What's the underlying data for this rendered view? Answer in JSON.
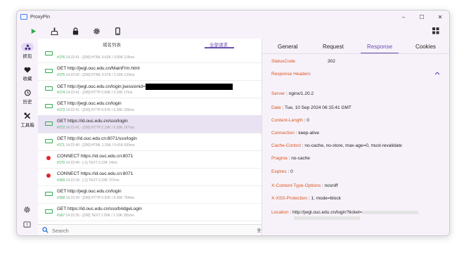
{
  "window": {
    "title": "ProxyPin",
    "controls": [
      "–",
      "☐",
      "✕"
    ]
  },
  "toolbar": {
    "icons": [
      "play-icon",
      "broom-icon",
      "lock-icon",
      "gear-icon",
      "phone-icon"
    ],
    "right_icon": "grid-icon"
  },
  "sidebar": {
    "items": [
      {
        "label": "抓包",
        "icon": "capture-icon",
        "active": true
      },
      {
        "label": "收藏",
        "icon": "heart-icon",
        "active": false
      },
      {
        "label": "历史",
        "icon": "history-icon",
        "active": false
      },
      {
        "label": "工具箱",
        "icon": "tools-icon",
        "active": false
      }
    ],
    "bottom_icons": [
      "settings-icon",
      "feedback-icon"
    ]
  },
  "list": {
    "subtabs": [
      "域名列表",
      "全部请求"
    ],
    "active_subtab": 1,
    "rows": [
      {
        "kind": "ok",
        "request": "",
        "id": "#176",
        "meta": " 14:22:41 - [200]  HTML 0.62K / 3.83K  115ms",
        "selected": false
      },
      {
        "kind": "ok",
        "request": "GET http://jwgl.ouc.edu.cn/MainFrm.html",
        "id": "#175",
        "meta": " 14:22:42 - [200]  HTML 0.57K / 2.16K  123ms",
        "selected": false
      },
      {
        "kind": "ok",
        "request": "GET http://jwgl.ouc.edu.cn/login;jsessionid=",
        "redacted": true,
        "id": "#174",
        "meta": " 14:22:41 - [200]  HTTP 0.60K / 0.20K  17ms",
        "selected": false
      },
      {
        "kind": "ok",
        "request": "GET http://jwgl.ouc.edu.cn/login",
        "id": "#173",
        "meta": " 14:22:41 - [200]  HTTP 0.57K / 0.30K  235ms",
        "selected": false
      },
      {
        "kind": "ok",
        "request": "GET https://id.ouc.edu.cn/sso/login",
        "id": "#172",
        "meta": " 14:22:41 - [200]  HTTP 2.19K / 0.30K  167ms",
        "selected": true
      },
      {
        "kind": "ok",
        "request": "GET http://id.ouc.edu.cn:8071/sso/login",
        "id": "#171",
        "meta": " 14:22:40 - [200]  HTML 1.30K / 0.41K  693ms",
        "selected": false
      },
      {
        "kind": "err",
        "request": "CONNECT https://id.ouc.edu.cn:8071",
        "id": "#170",
        "meta": " 14:22:40 - [-1]  TEXT 0.23K  14ms",
        "selected": false
      },
      {
        "kind": "err",
        "request": "CONNECT https://id.ouc.edu.cn:8071",
        "id": "#169",
        "meta": " 14:22:39 - [-1]  TEXT 0.23K  737ms",
        "selected": false
      },
      {
        "kind": "ok",
        "request": "GET http://jwgl.ouc.edu.cn/login",
        "id": "#168",
        "meta": " 14:22:39 - [200]  HTTP 0.52K / 0.30K  754ms",
        "selected": false
      },
      {
        "kind": "ok",
        "request": "GET https://id.ouc.edu.cn/sso/bridgeLogin",
        "id": "#167",
        "meta": " 14:22:35 - [200]  TEXT 1.56K / 1.10K  355ms",
        "selected": false
      }
    ],
    "search_placeholder": "Search",
    "filter_label": "全部 ▴"
  },
  "detail": {
    "tabs": [
      "General",
      "Request",
      "Response",
      "Cookies"
    ],
    "active_tab": 2,
    "status": {
      "key": "StatusCode",
      "value": "302"
    },
    "section": "Response Headers",
    "headers": [
      {
        "key": "Server",
        "value": "nginx/1.20.2"
      },
      {
        "key": "Date",
        "value": "Tue, 10 Sep 2024 06:15:41 GMT"
      },
      {
        "key": "Content-Length",
        "value": "0"
      },
      {
        "key": "Connection",
        "value": "keep-alive"
      },
      {
        "key": "Cache-Control",
        "value": "no-cache, no-store, max-age=0, must-revalidate"
      },
      {
        "key": "Pragma",
        "value": "no-cache"
      },
      {
        "key": "Expires",
        "value": "0"
      },
      {
        "key": "X-Content-Type-Options",
        "value": "nosniff"
      },
      {
        "key": "X-XSS-Protection",
        "value": "1; mode=block"
      },
      {
        "key": "Location",
        "value": "http://jwgl.ouc.edu.cn/login?ticket="
      }
    ]
  },
  "colors": {
    "accent": "#6b4fb0",
    "header_key": "#d9541e",
    "ok": "#2eaa4a",
    "error": "#e3242b"
  }
}
